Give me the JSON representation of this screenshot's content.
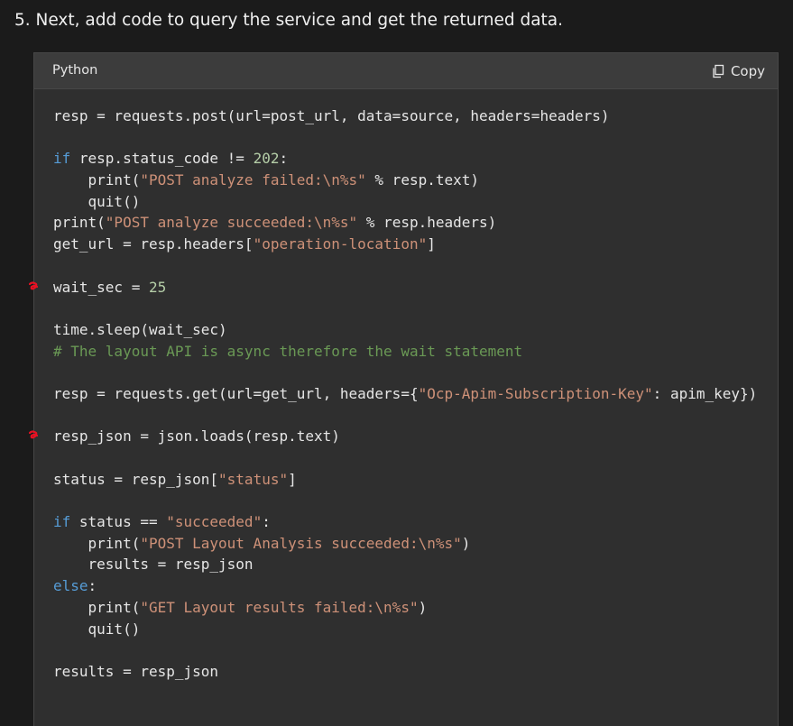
{
  "step": {
    "heading": "5. Next, add code to query the service and get the returned data."
  },
  "code_block": {
    "language": "Python",
    "copy_label": "Copy",
    "lines": [
      [
        [
          "plain",
          "resp = requests.post(url=post_url, data=source, headers=headers)"
        ]
      ],
      [],
      [
        [
          "kw",
          "if"
        ],
        [
          "plain",
          " resp.status_code != "
        ],
        [
          "num",
          "202"
        ],
        [
          "plain",
          ":"
        ]
      ],
      [
        [
          "plain",
          "    print("
        ],
        [
          "str",
          "\"POST analyze failed:\\n%s\""
        ],
        [
          "plain",
          " % resp.text)"
        ]
      ],
      [
        [
          "plain",
          "    quit()"
        ]
      ],
      [
        [
          "plain",
          "print("
        ],
        [
          "str",
          "\"POST analyze succeeded:\\n%s\""
        ],
        [
          "plain",
          " % resp.headers)"
        ]
      ],
      [
        [
          "plain",
          "get_url = resp.headers["
        ],
        [
          "str",
          "\"operation-location\""
        ],
        [
          "plain",
          "]"
        ]
      ],
      [],
      [
        [
          "plain",
          "wait_sec = "
        ],
        [
          "num",
          "25"
        ]
      ],
      [],
      [
        [
          "plain",
          "time.sleep(wait_sec)"
        ]
      ],
      [
        [
          "cmt",
          "# The layout API is async therefore the wait statement"
        ]
      ],
      [],
      [
        [
          "plain",
          "resp = requests.get(url=get_url, headers={"
        ],
        [
          "str",
          "\"Ocp-Apim-Subscription-Key\""
        ],
        [
          "plain",
          ": apim_key})"
        ]
      ],
      [],
      [
        [
          "plain",
          "resp_json = json.loads(resp.text)"
        ]
      ],
      [],
      [
        [
          "plain",
          "status = resp_json["
        ],
        [
          "str",
          "\"status\""
        ],
        [
          "plain",
          "]"
        ]
      ],
      [],
      [
        [
          "kw",
          "if"
        ],
        [
          "plain",
          " status == "
        ],
        [
          "str",
          "\"succeeded\""
        ],
        [
          "plain",
          ":"
        ]
      ],
      [
        [
          "plain",
          "    print("
        ],
        [
          "str",
          "\"POST Layout Analysis succeeded:\\n%s\""
        ],
        [
          "plain",
          ")"
        ]
      ],
      [
        [
          "plain",
          "    results = resp_json"
        ]
      ],
      [
        [
          "kw",
          "else"
        ],
        [
          "plain",
          ":"
        ]
      ],
      [
        [
          "plain",
          "    print("
        ],
        [
          "str",
          "\"GET Layout results failed:\\n%s\""
        ],
        [
          "plain",
          ")"
        ]
      ],
      [
        [
          "plain",
          "    quit()"
        ]
      ],
      [],
      [
        [
          "plain",
          "results = resp_json"
        ]
      ]
    ],
    "marked_lines": [
      8,
      15
    ]
  },
  "icons": {
    "copy": "copy-icon",
    "annotation": "red-annotation-mark-icon"
  },
  "colors": {
    "background": "#1b1b1b",
    "card": "#2f2f2f",
    "header": "#3c3c3c",
    "keyword": "#569cd6",
    "string": "#ce9178",
    "number": "#b5cea8",
    "comment": "#6a9955",
    "annotation": "#e81123"
  }
}
